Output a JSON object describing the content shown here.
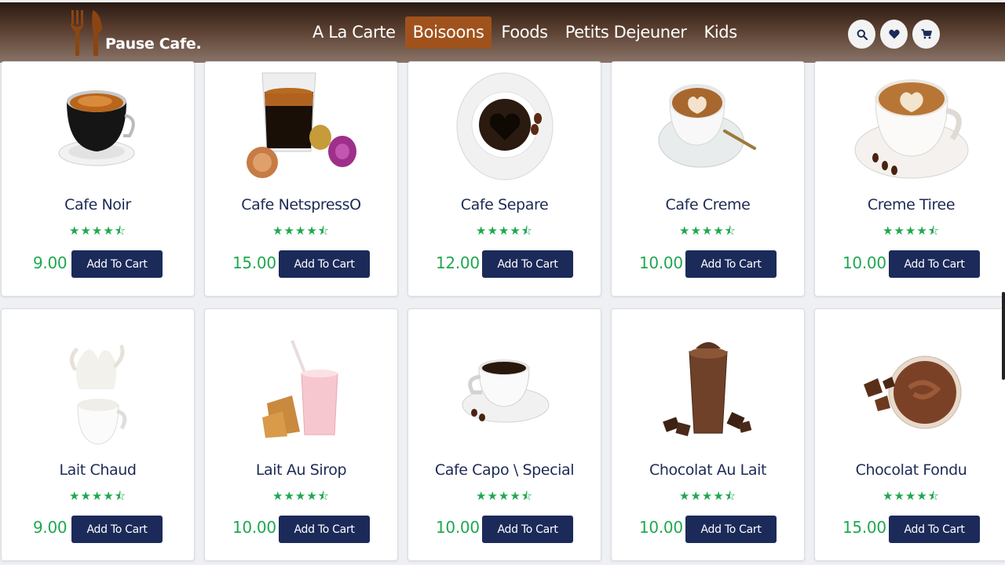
{
  "brand": {
    "name": "Pause Cafe."
  },
  "nav": [
    {
      "label": "A La Carte",
      "active": false
    },
    {
      "label": "Boisoons",
      "active": true
    },
    {
      "label": "Foods",
      "active": false
    },
    {
      "label": "Petits Dejeuner",
      "active": false
    },
    {
      "label": "Kids",
      "active": false
    }
  ],
  "header_icons": [
    "search-icon",
    "heart-icon",
    "cart-icon"
  ],
  "colors": {
    "accent": "#a0521c",
    "price": "#1fa84f",
    "button": "#1b2a59",
    "title": "#1d2a55"
  },
  "rating_stars": "★★★★⯪",
  "button_label": "Add To Cart",
  "products": [
    {
      "name": "Cafe Noir",
      "price": "9.00",
      "rating": 4.5,
      "image": "espresso-cup"
    },
    {
      "name": "Cafe NetspressO",
      "price": "15.00",
      "rating": 4.5,
      "image": "espresso-glass-capsules"
    },
    {
      "name": "Cafe Separe",
      "price": "12.00",
      "rating": 4.5,
      "image": "black-coffee-heart"
    },
    {
      "name": "Cafe Creme",
      "price": "10.00",
      "rating": 4.5,
      "image": "latte-art-cup"
    },
    {
      "name": "Creme Tiree",
      "price": "10.00",
      "rating": 4.5,
      "image": "cappuccino-cup"
    },
    {
      "name": "Lait Chaud",
      "price": "9.00",
      "rating": 4.5,
      "image": "milk-splash"
    },
    {
      "name": "Lait Au Sirop",
      "price": "10.00",
      "rating": 4.5,
      "image": "pink-milkshake"
    },
    {
      "name": "Cafe Capo \\ Special",
      "price": "10.00",
      "rating": 4.5,
      "image": "coffee-cup-steam"
    },
    {
      "name": "Chocolat Au Lait",
      "price": "10.00",
      "rating": 4.5,
      "image": "chocolate-drink"
    },
    {
      "name": "Chocolat Fondu",
      "price": "15.00",
      "rating": 4.5,
      "image": "melted-chocolate"
    }
  ]
}
